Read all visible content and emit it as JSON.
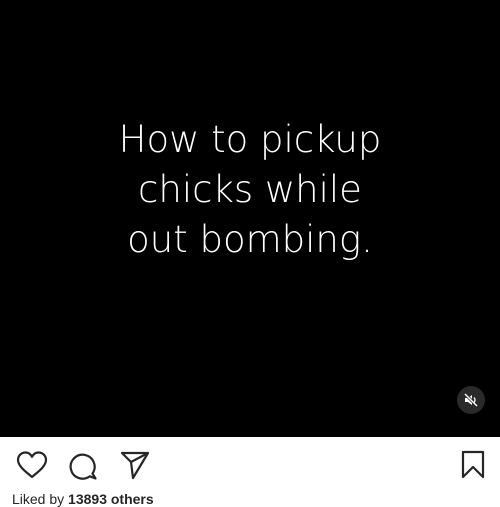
{
  "video": {
    "caption_lines": [
      "How to pickup",
      "chicks while",
      "out bombing."
    ],
    "sound_state": "muted",
    "mute_icon": "speaker-muted-icon"
  },
  "actions": {
    "like_icon": "heart-icon",
    "comment_icon": "comment-icon",
    "share_icon": "paper-plane-icon",
    "save_icon": "bookmark-icon"
  },
  "likes": {
    "prefix": "Liked by ",
    "count_text": "13893 others"
  },
  "colors": {
    "video_bg": "#000000",
    "caption_text": "#ffffff",
    "icon_stroke": "#262626",
    "page_bg": "#ffffff"
  }
}
